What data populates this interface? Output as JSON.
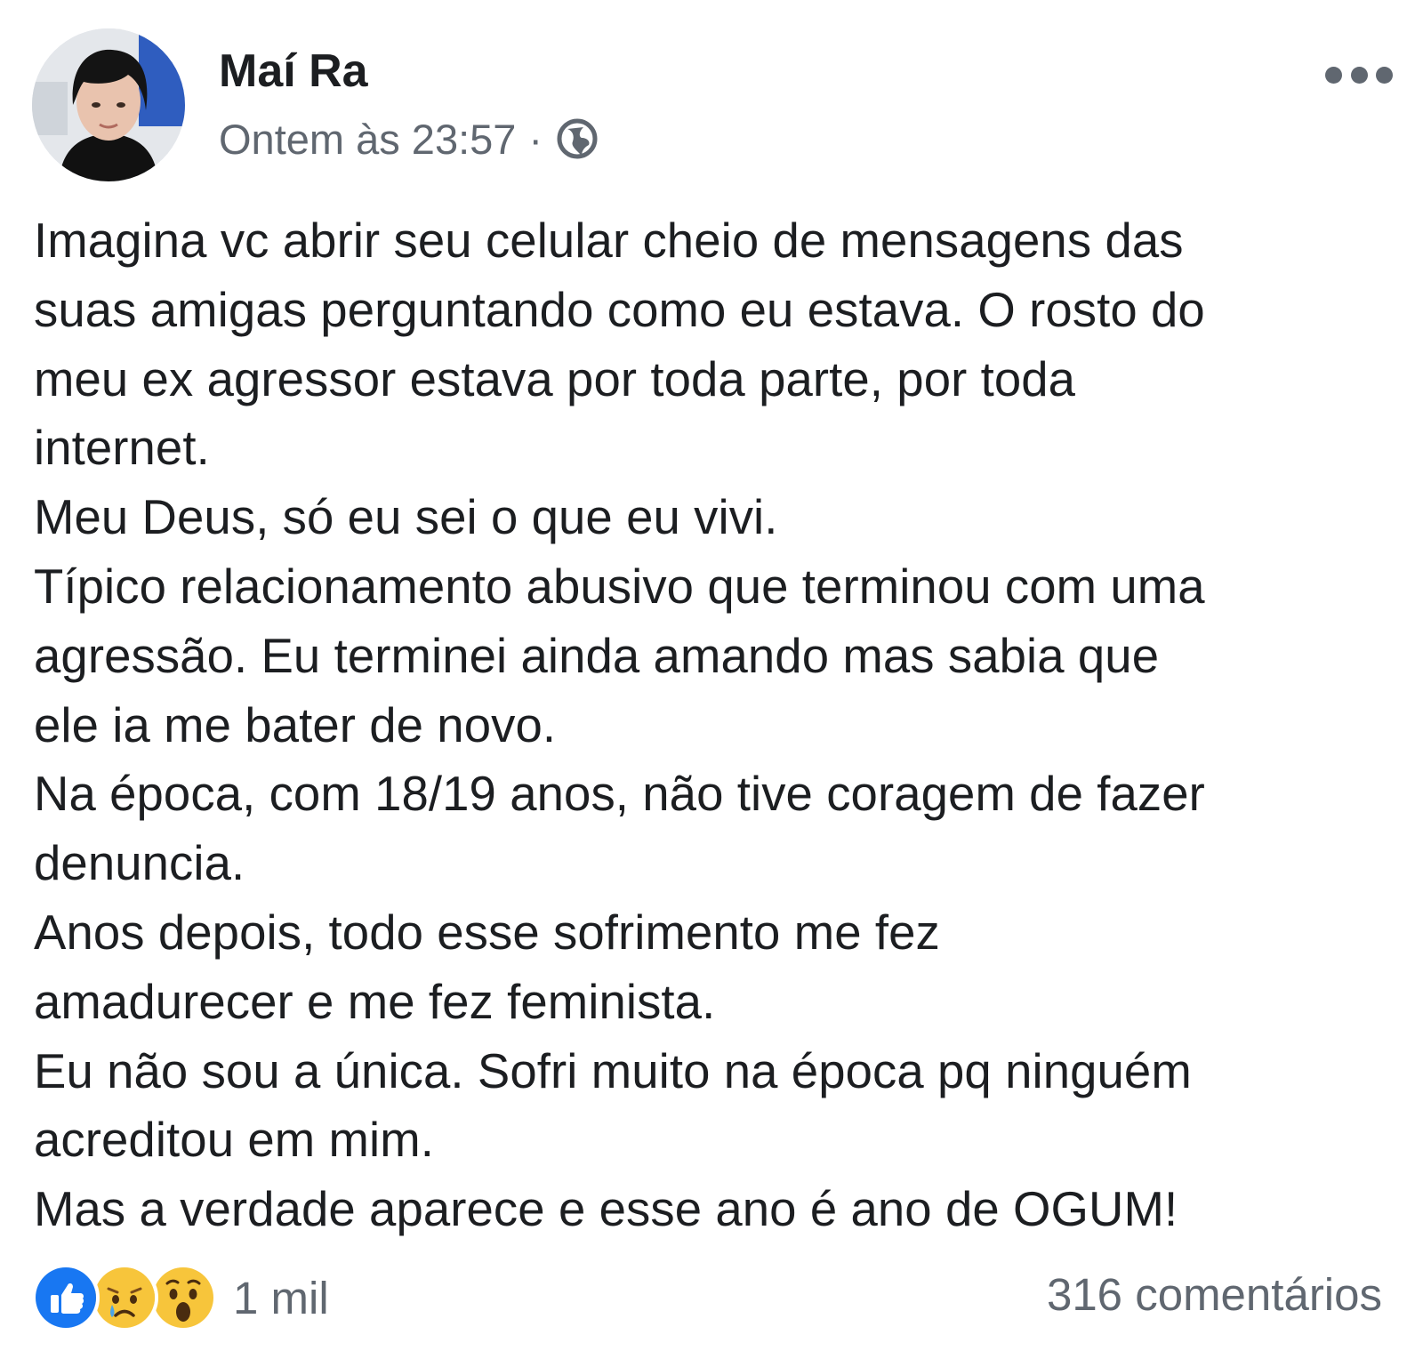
{
  "post": {
    "author": "Maí Ra",
    "timestamp": "Ontem às 23:57",
    "separator": "·",
    "privacy_icon": "globe-icon",
    "more_icon": "more-options-icon",
    "body_lines": [
      "Imagina vc abrir seu celular cheio de mensagens das",
      "suas amigas perguntando como eu estava. O rosto do",
      "meu ex agressor estava por toda parte, por toda",
      "internet.",
      "Meu Deus, só eu sei o que eu vivi.",
      "Típico relacionamento abusivo que terminou com uma",
      "agressão. Eu terminei ainda amando mas sabia que",
      "ele ia me bater de novo.",
      "Na época, com 18/19 anos, não tive coragem de fazer",
      "denuncia.",
      "Anos depois, todo esse sofrimento me fez",
      "amadurecer e me fez feminista.",
      "Eu não sou a única. Sofri muito na época pq ninguém",
      "acreditou em mim.",
      "Mas a verdade aparece e esse ano é ano de OGUM!"
    ],
    "reactions": {
      "icons": [
        "like-icon",
        "sad-icon",
        "wow-icon"
      ],
      "count": "1 mil"
    },
    "comments": "316 comentários",
    "colors": {
      "like_blue": "#1877f2",
      "emoji_yellow": "#f7c53b",
      "secondary_text": "#606770",
      "primary_text": "#1c1e21"
    }
  }
}
